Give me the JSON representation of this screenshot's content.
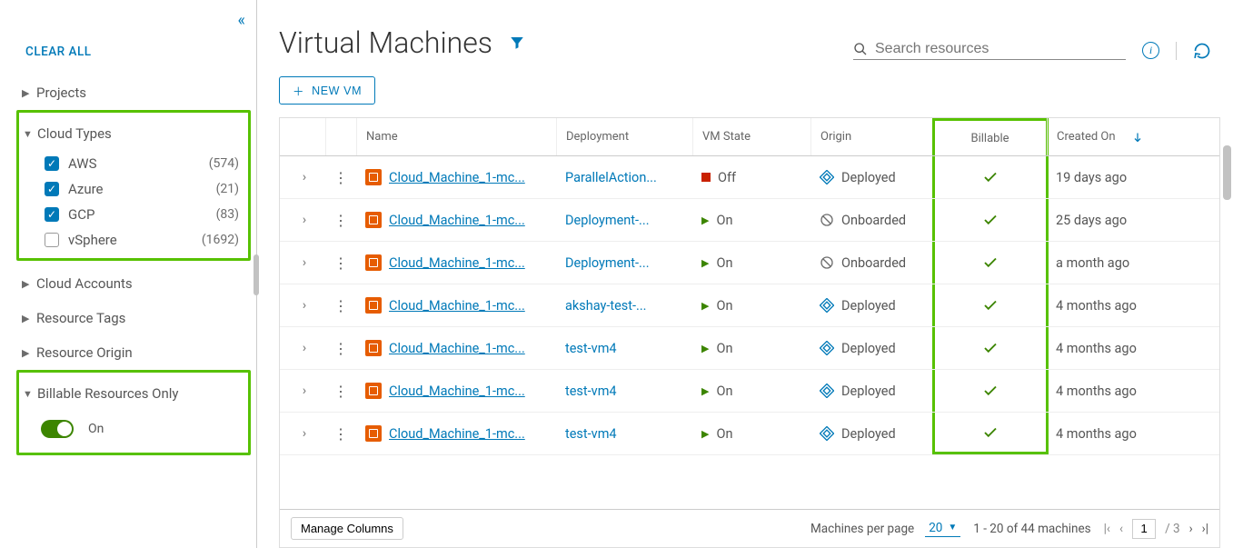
{
  "sidebar": {
    "clear_all": "CLEAR ALL",
    "sections": {
      "projects": {
        "label": "Projects",
        "expanded": false
      },
      "cloud_types": {
        "label": "Cloud Types",
        "expanded": true,
        "options": [
          {
            "label": "AWS",
            "count": "(574)",
            "checked": true
          },
          {
            "label": "Azure",
            "count": "(21)",
            "checked": true
          },
          {
            "label": "GCP",
            "count": "(83)",
            "checked": true
          },
          {
            "label": "vSphere",
            "count": "(1692)",
            "checked": false
          }
        ]
      },
      "cloud_accounts": {
        "label": "Cloud Accounts",
        "expanded": false
      },
      "resource_tags": {
        "label": "Resource Tags",
        "expanded": false
      },
      "resource_origin": {
        "label": "Resource Origin",
        "expanded": false
      },
      "billable": {
        "label": "Billable Resources Only",
        "expanded": true,
        "toggle_label": "On"
      }
    }
  },
  "header": {
    "title": "Virtual Machines",
    "search_placeholder": "Search resources",
    "new_vm_label": "NEW VM"
  },
  "table": {
    "columns": {
      "name": "Name",
      "deployment": "Deployment",
      "vm_state": "VM State",
      "origin": "Origin",
      "billable": "Billable",
      "created": "Created On"
    },
    "rows": [
      {
        "name": "Cloud_Machine_1-mc...",
        "deployment": "ParallelAction...",
        "state": "Off",
        "state_kind": "off",
        "origin": "Deployed",
        "origin_kind": "deployed",
        "billable": true,
        "created": "19 days ago"
      },
      {
        "name": "Cloud_Machine_1-mc...",
        "deployment": "Deployment-...",
        "state": "On",
        "state_kind": "on",
        "origin": "Onboarded",
        "origin_kind": "onboarded",
        "billable": true,
        "created": "25 days ago"
      },
      {
        "name": "Cloud_Machine_1-mc...",
        "deployment": "Deployment-...",
        "state": "On",
        "state_kind": "on",
        "origin": "Onboarded",
        "origin_kind": "onboarded",
        "billable": true,
        "created": "a month ago"
      },
      {
        "name": "Cloud_Machine_1-mc...",
        "deployment": "akshay-test-...",
        "state": "On",
        "state_kind": "on",
        "origin": "Deployed",
        "origin_kind": "deployed",
        "billable": true,
        "created": "4 months ago"
      },
      {
        "name": "Cloud_Machine_1-mc...",
        "deployment": "test-vm4",
        "state": "On",
        "state_kind": "on",
        "origin": "Deployed",
        "origin_kind": "deployed",
        "billable": true,
        "created": "4 months ago"
      },
      {
        "name": "Cloud_Machine_1-mc...",
        "deployment": "test-vm4",
        "state": "On",
        "state_kind": "on",
        "origin": "Deployed",
        "origin_kind": "deployed",
        "billable": true,
        "created": "4 months ago"
      },
      {
        "name": "Cloud_Machine_1-mc...",
        "deployment": "test-vm4",
        "state": "On",
        "state_kind": "on",
        "origin": "Deployed",
        "origin_kind": "deployed",
        "billable": true,
        "created": "4 months ago"
      }
    ]
  },
  "footer": {
    "manage_columns": "Manage Columns",
    "per_page_label": "Machines per page",
    "per_page_value": "20",
    "range": "1 - 20 of 44 machines",
    "page_current": "1",
    "page_total": "/ 3"
  }
}
